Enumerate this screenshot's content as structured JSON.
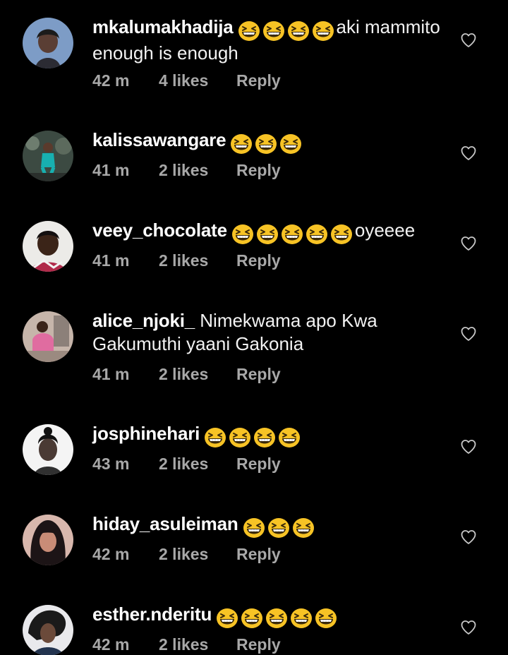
{
  "comments": [
    {
      "username": "mkalumakhadija",
      "emoji_count": 4,
      "text": "aki mammito enough is enough",
      "time": "42 m",
      "likes": "4 likes",
      "reply": "Reply",
      "avatar_color": "#6a8bb8"
    },
    {
      "username": "kalissawangare",
      "emoji_count": 3,
      "text": "",
      "time": "41 m",
      "likes": "2 likes",
      "reply": "Reply",
      "avatar_color": "#3b4a3f"
    },
    {
      "username": "veey_chocolate",
      "emoji_count": 5,
      "text": "oyeeee",
      "time": "41 m",
      "likes": "2 likes",
      "reply": "Reply",
      "avatar_color": "#d9d2cc"
    },
    {
      "username": "alice_njoki_",
      "emoji_count": 0,
      "text": "Nimekwama apo Kwa Gakumuthi yaani Gakonia",
      "time": "41 m",
      "likes": "2 likes",
      "reply": "Reply",
      "avatar_color": "#b8a49a"
    },
    {
      "username": "josphinehari",
      "emoji_count": 4,
      "text": "",
      "time": "43 m",
      "likes": "2 likes",
      "reply": "Reply",
      "avatar_color": "#e6e6e6"
    },
    {
      "username": "hiday_asuleiman",
      "emoji_count": 3,
      "text": "",
      "time": "42 m",
      "likes": "2 likes",
      "reply": "Reply",
      "avatar_color": "#c8a59a"
    },
    {
      "username": "esther.nderitu",
      "emoji_count": 5,
      "text": "",
      "time": "42 m",
      "likes": "2 likes",
      "reply": "Reply",
      "avatar_color": "#2a3a52"
    }
  ],
  "icons": {
    "like": "heart-outline-icon",
    "emoji": "grinning-squinting-face-emoji"
  },
  "colors": {
    "background": "#000000",
    "text": "#ffffff",
    "meta": "#a8a8a8",
    "emoji_face": "#f7c325"
  }
}
